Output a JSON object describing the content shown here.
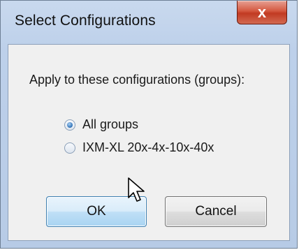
{
  "window": {
    "title": "Select Configurations",
    "close_glyph": "x"
  },
  "dialog": {
    "prompt": "Apply to these configurations (groups):",
    "options": [
      {
        "label": "All groups",
        "selected": true
      },
      {
        "label": "IXM-XL 20x-4x-10x-40x",
        "selected": false
      }
    ]
  },
  "buttons": {
    "ok_label": "OK",
    "cancel_label": "Cancel"
  },
  "icons": {
    "close": "close-icon",
    "cursor": "mouse-pointer-icon"
  },
  "colors": {
    "title_bar": "#bdd0ea",
    "close_button": "#c13a22",
    "ok_border": "#3c7fb1"
  }
}
